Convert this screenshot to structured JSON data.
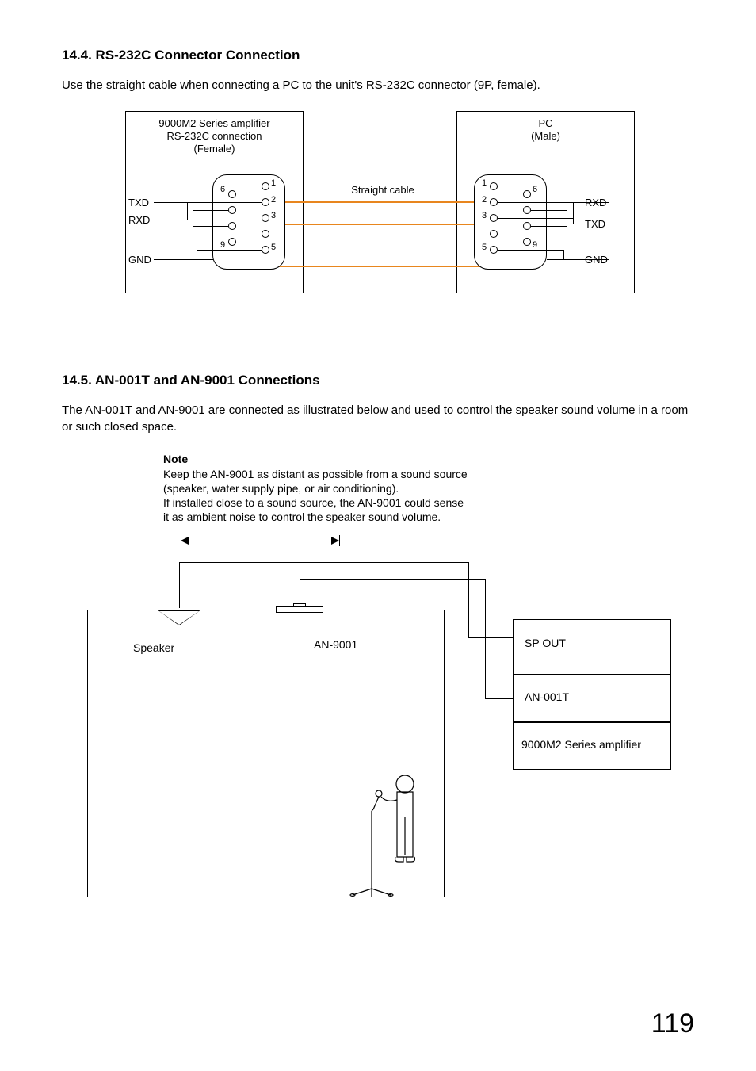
{
  "section1": {
    "heading": "14.4. RS-232C Connector Connection",
    "paragraph": "Use the straight cable when connecting a PC to the unit's RS-232C connector (9P, female).",
    "left_box_line1": "9000M2 Series amplifier",
    "left_box_line2": "RS-232C connection",
    "left_box_line3": "(Female)",
    "cable_label": "Straight cable",
    "right_box_line1": "PC",
    "right_box_line2": "(Male)",
    "left_signals": {
      "txd": "TXD",
      "rxd": "RXD",
      "gnd": "GND"
    },
    "right_signals": {
      "rxd": "RXD",
      "txd": "TXD",
      "gnd": "GND"
    },
    "pins_left": {
      "p1": "1",
      "p2": "2",
      "p3": "3",
      "p5": "5",
      "p6": "6",
      "p9": "9"
    },
    "pins_right": {
      "p1": "1",
      "p2": "2",
      "p3": "3",
      "p5": "5",
      "p6": "6",
      "p9": "9"
    }
  },
  "section2": {
    "heading": "14.5. AN-001T and AN-9001 Connections",
    "paragraph": "The AN-001T and AN-9001 are connected as illustrated below and used to control the speaker sound volume in a room or such closed space.",
    "note_title": "Note",
    "note_line1": "Keep the AN-9001 as distant as possible from a sound source",
    "note_line2": "(speaker, water supply pipe, or air conditioning).",
    "note_line3": "If installed close to a sound source, the AN-9001 could sense",
    "note_line4": "it as ambient noise to control the speaker sound volume.",
    "labels": {
      "speaker": "Speaker",
      "an9001": "AN-9001",
      "sp_out": "SP OUT",
      "an001t": "AN-001T",
      "amp": "9000M2 Series amplifier"
    }
  },
  "page_number": "119"
}
